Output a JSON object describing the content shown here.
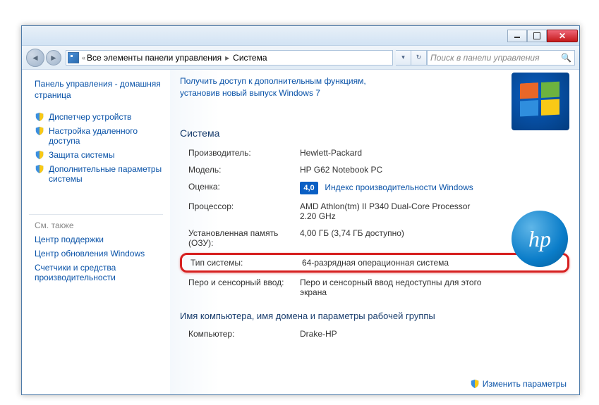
{
  "breadcrumb": {
    "root": "Все элементы панели управления",
    "current": "Система"
  },
  "search": {
    "placeholder": "Поиск в панели управления"
  },
  "sidebar": {
    "home": "Панель управления - домашняя страница",
    "items": [
      "Диспетчер устройств",
      "Настройка удаленного доступа",
      "Защита системы",
      "Дополнительные параметры системы"
    ],
    "see_also_title": "См. также",
    "see_also": [
      "Центр поддержки",
      "Центр обновления Windows",
      "Счетчики и средства производительности"
    ]
  },
  "content": {
    "update_text": "Получить доступ к дополнительным функциям, установив новый выпуск Windows 7",
    "system_section": "Система",
    "rows": {
      "manufacturer_label": "Производитель:",
      "manufacturer_val": "Hewlett-Packard",
      "model_label": "Модель:",
      "model_val": "HP G62 Notebook PC",
      "rating_label": "Оценка:",
      "rating_badge": "4,0",
      "rating_link": "Индекс производительности Windows",
      "cpu_label": "Процессор:",
      "cpu_val": "AMD Athlon(tm) II P340 Dual-Core Processor   2.20 GHz",
      "ram_label": "Установленная память (ОЗУ):",
      "ram_val": "4,00 ГБ (3,74 ГБ доступно)",
      "systype_label": "Тип системы:",
      "systype_val": "64-разрядная операционная система",
      "pen_label": "Перо и сенсорный ввод:",
      "pen_val": "Перо и сенсорный ввод недоступны для этого экрана"
    },
    "workgroup_section": "Имя компьютера, имя домена и параметры рабочей группы",
    "computer_label": "Компьютер:",
    "computer_val": "Drake-HP",
    "change_link": "Изменить параметры"
  },
  "hp_logo_text": "hp"
}
